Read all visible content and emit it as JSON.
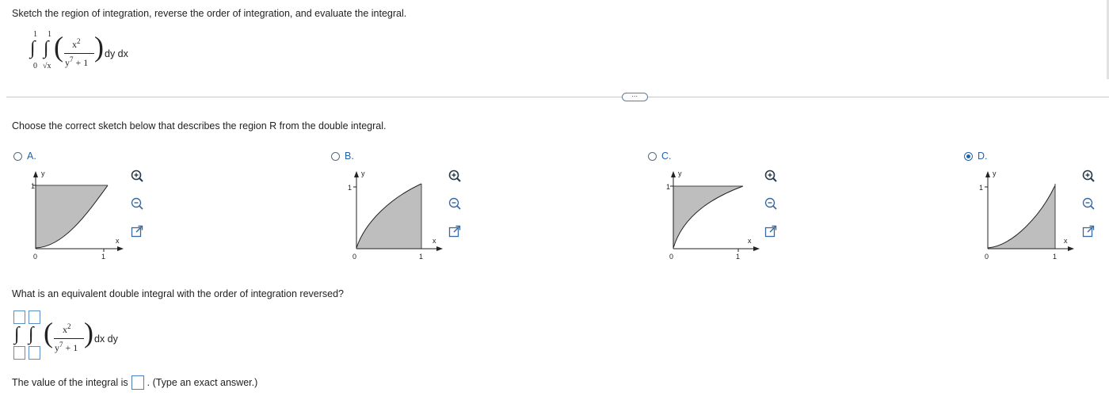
{
  "prompt": "Sketch the region of integration, reverse the order of integration, and evaluate the integral.",
  "integral1": {
    "outer_upper": "1",
    "outer_lower": "0",
    "inner_upper": "1",
    "inner_lower": "√x",
    "numer": "x",
    "numer_exp": "2",
    "denom_base": "y",
    "denom_exp": "7",
    "denom_tail": "+ 1",
    "differentials": "dy dx"
  },
  "divider": {
    "label": "⋯"
  },
  "choose_text": "Choose the correct sketch below that describes the region R from the double integral.",
  "options": [
    {
      "label": "A.",
      "selected": false
    },
    {
      "label": "B.",
      "selected": false
    },
    {
      "label": "C.",
      "selected": false
    },
    {
      "label": "D.",
      "selected": true
    }
  ],
  "graph_labels": {
    "y": "y",
    "x": "x",
    "one": "1",
    "zero": "0"
  },
  "question2": "What is an equivalent double integral with the order of integration reversed?",
  "integral2": {
    "numer": "x",
    "numer_exp": "2",
    "denom_base": "y",
    "denom_exp": "7",
    "denom_tail": "+ 1",
    "differentials": "dx dy"
  },
  "answer": {
    "prefix": "The value of the integral is",
    "suffix": ". (Type an exact answer.)"
  },
  "colors": {
    "link_blue": "#2462a6",
    "shade": "#bebebe"
  }
}
